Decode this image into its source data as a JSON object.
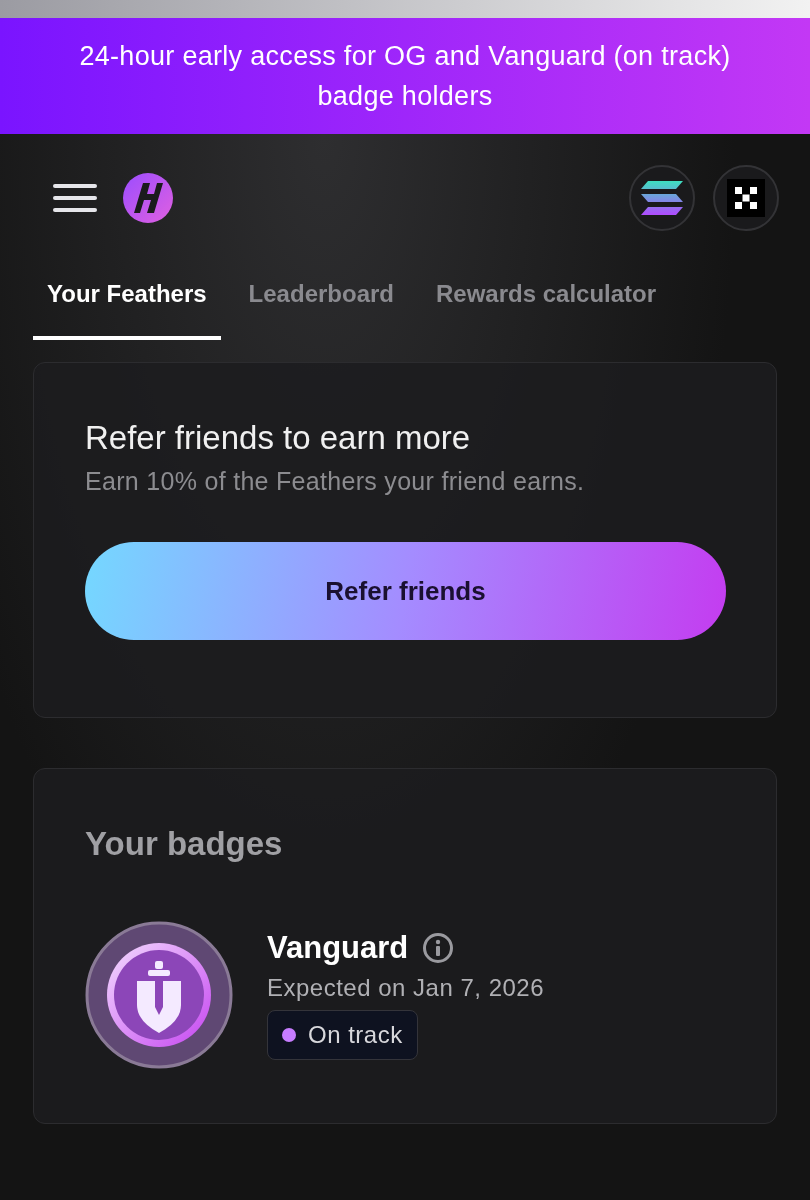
{
  "banner": {
    "text": "24-hour early access for OG and Vanguard (on track) badge holders"
  },
  "tabs": [
    {
      "label": "Your Feathers",
      "selected": true
    },
    {
      "label": "Leaderboard",
      "selected": false
    },
    {
      "label": "Rewards calculator",
      "selected": false
    }
  ],
  "referral": {
    "title": "Refer friends to earn more",
    "subtitle": "Earn 10% of the Feathers your friend earns.",
    "button": "Refer friends"
  },
  "badges": {
    "title": "Your badges",
    "items": [
      {
        "name": "Vanguard",
        "expected": "Expected on Jan 7, 2026",
        "status": "On track",
        "color": "#c77dff"
      }
    ]
  }
}
